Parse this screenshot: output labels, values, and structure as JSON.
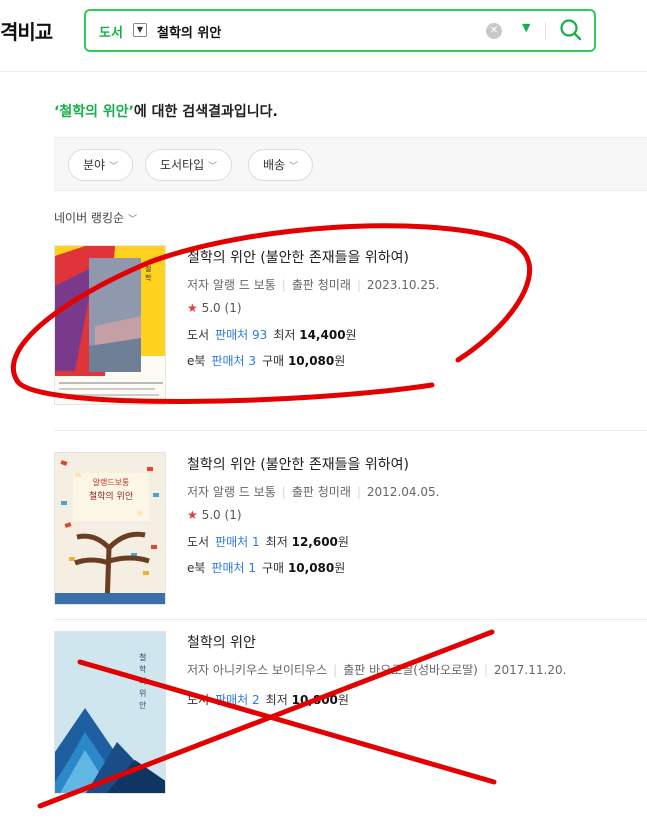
{
  "header": {
    "logo": "격비교",
    "scope": "도서",
    "query": "철학의 위안"
  },
  "results": {
    "heading_query": "‘철학의 위안’",
    "heading_suffix": "에 대한 검색결과입니다."
  },
  "filters": [
    "분야",
    "도서타입",
    "배송"
  ],
  "sort_label": "네이버 랭킹순",
  "books": [
    {
      "title": "철학의 위안 (불안한 존재들을 위하여)",
      "author_label": "저자",
      "author": "알랭 드 보통",
      "publisher_label": "출판",
      "publisher": "청미래",
      "date": "2023.10.25.",
      "rating": "5.0",
      "rating_count": "(1)",
      "price_lines": [
        {
          "type": "도서",
          "sellers": "판매처 93",
          "price_label": "최저",
          "price": "14,400",
          "unit": "원"
        },
        {
          "type": "e북",
          "sellers": "판매처 3",
          "price_label": "구매",
          "price": "10,080",
          "unit": "원"
        }
      ]
    },
    {
      "title": "철학의 위안 (불안한 존재들을 위하여)",
      "author_label": "저자",
      "author": "알랭 드 보통",
      "publisher_label": "출판",
      "publisher": "청미래",
      "date": "2012.04.05.",
      "rating": "5.0",
      "rating_count": "(1)",
      "price_lines": [
        {
          "type": "도서",
          "sellers": "판매처 1",
          "price_label": "최저",
          "price": "12,600",
          "unit": "원"
        },
        {
          "type": "e북",
          "sellers": "판매처 1",
          "price_label": "구매",
          "price": "10,080",
          "unit": "원"
        }
      ]
    },
    {
      "title": "철학의 위안",
      "author_label": "저자",
      "author": "아니키우스 보이티우스",
      "publisher_label": "출판",
      "publisher": "바오로딸(성바오로딸)",
      "date": "2017.11.20.",
      "price_lines": [
        {
          "type": "도서",
          "sellers": "판매처 2",
          "price_label": "최저",
          "price": "10,800",
          "unit": "원"
        }
      ]
    }
  ],
  "colors": {
    "brand_green": "#16b04a",
    "link_blue": "#2a7ae2",
    "star_red": "#e8393b",
    "annotation_red": "#e30000"
  }
}
